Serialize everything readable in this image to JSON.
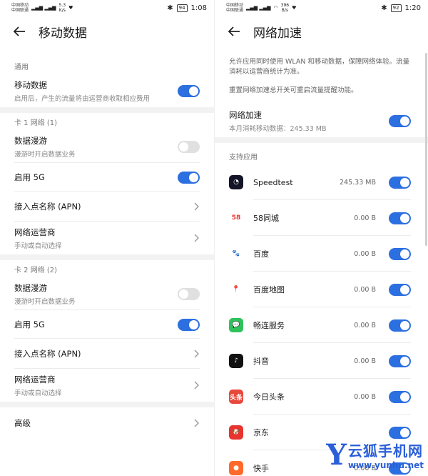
{
  "left": {
    "status": {
      "carrier1": "中国移动",
      "carrier2": "中国联通",
      "speed_top": "5.3",
      "speed_unit": "K/s",
      "battery": "94",
      "time": "1:08"
    },
    "title": "移动数据",
    "general": {
      "header": "通用",
      "mobile_data": {
        "label": "移动数据",
        "desc": "启用后，产生的流量将由运营商收取相应费用",
        "on": true
      }
    },
    "sim1": {
      "header": "卡 1 网络 (1)",
      "roaming": {
        "label": "数据漫游",
        "desc": "漫游时开启数据业务",
        "on": false
      },
      "five_g": {
        "label": "启用 5G",
        "on": true
      },
      "apn": {
        "label": "接入点名称 (APN)"
      },
      "operator": {
        "label": "网络运营商",
        "desc": "手动或自动选择"
      }
    },
    "sim2": {
      "header": "卡 2 网络 (2)",
      "roaming": {
        "label": "数据漫游",
        "desc": "漫游时开启数据业务",
        "on": false
      },
      "five_g": {
        "label": "启用 5G",
        "on": true
      },
      "apn": {
        "label": "接入点名称 (APN)"
      },
      "operator": {
        "label": "网络运营商",
        "desc": "手动或自动选择"
      }
    },
    "advanced": {
      "label": "高级"
    }
  },
  "right": {
    "status": {
      "carrier1": "中国移动",
      "carrier2": "中国联通",
      "speed_top": "396",
      "speed_unit": "B/s",
      "battery": "92",
      "time": "1:20"
    },
    "title": "网络加速",
    "desc1": "允许应用同时使用 WLAN 和移动数据，保障网络体验。流量消耗以运营商统计为准。",
    "desc2": "重置网络加速总开关可重启流量提醒功能。",
    "accel": {
      "label": "网络加速",
      "usage": "本月消耗移动数据：245.33 MB",
      "on": true
    },
    "apps_header": "支持应用",
    "apps": [
      {
        "name": "Speedtest",
        "usage": "245.33 MB",
        "icon": "speedtest-icon",
        "color": "#141526",
        "glyph": "◔"
      },
      {
        "name": "58同城",
        "usage": "0.00 B",
        "icon": "58-icon",
        "color": "#ffffff",
        "glyph": "58"
      },
      {
        "name": "百度",
        "usage": "0.00 B",
        "icon": "baidu-paw-icon",
        "color": "#ffffff",
        "glyph": "🐾"
      },
      {
        "name": "百度地图",
        "usage": "0.00 B",
        "icon": "baidu-map-pin-icon",
        "color": "#ffffff",
        "glyph": "📍"
      },
      {
        "name": "畅连服务",
        "usage": "0.00 B",
        "icon": "chat-bubble-icon",
        "color": "#2fc25b",
        "glyph": "💬"
      },
      {
        "name": "抖音",
        "usage": "0.00 B",
        "icon": "tiktok-note-icon",
        "color": "#111111",
        "glyph": "♪"
      },
      {
        "name": "今日头条",
        "usage": "0.00 B",
        "icon": "toutiao-icon",
        "color": "#e8483b",
        "glyph": "头条"
      },
      {
        "name": "京东",
        "usage": "",
        "icon": "jd-dog-icon",
        "color": "#e8332e",
        "glyph": "🐶"
      },
      {
        "name": "快手",
        "usage": "0.00 B",
        "icon": "kuaishou-icon",
        "color": "#ff6a2a",
        "glyph": "●"
      }
    ]
  },
  "watermark": {
    "letter": "Y",
    "cn": "云狐手机网",
    "url": "www.yunhu.net"
  }
}
